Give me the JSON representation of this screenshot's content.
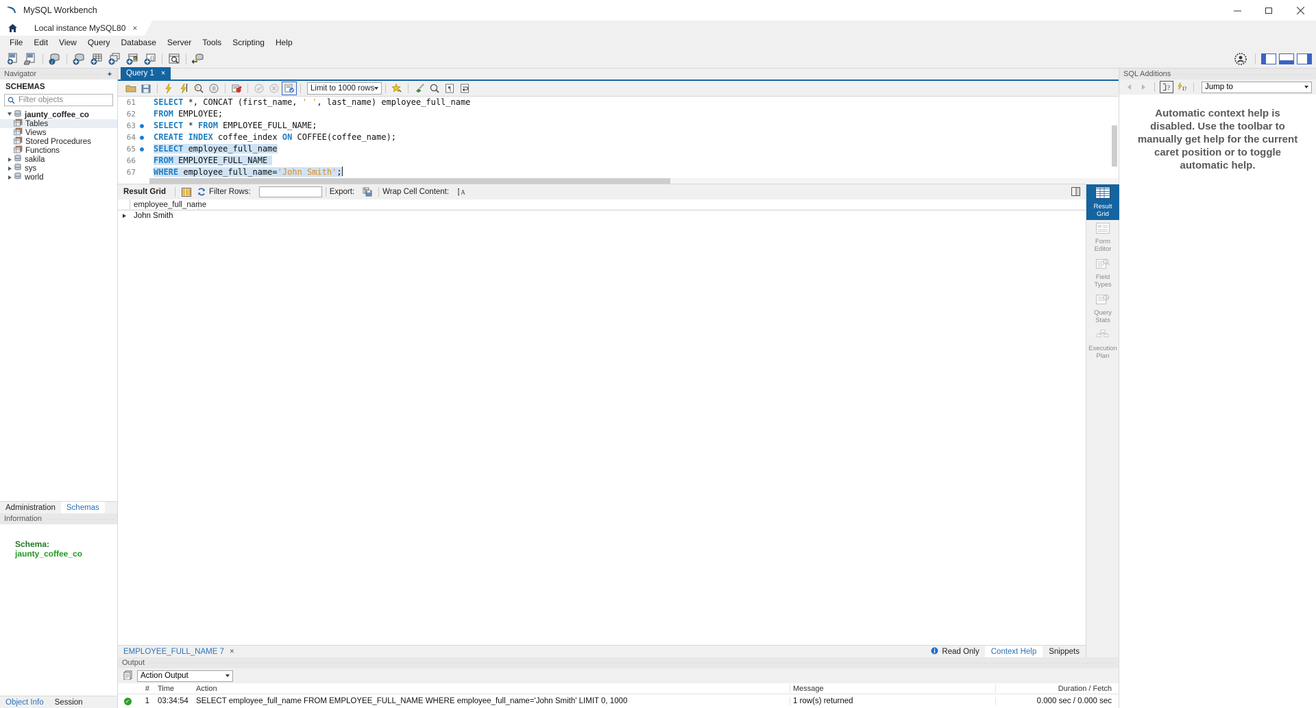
{
  "window": {
    "title": "MySQL Workbench",
    "icon": "mysql-dolphin-icon",
    "minimize": "minimize",
    "maximize": "maximize",
    "close": "close"
  },
  "tabs": {
    "home": "home-icon",
    "instance": "Local instance MySQL80",
    "instance_close": "×"
  },
  "menu": {
    "items": [
      "File",
      "Edit",
      "View",
      "Query",
      "Database",
      "Server",
      "Tools",
      "Scripting",
      "Help"
    ]
  },
  "toolbar": {
    "icons": [
      "new-sql-tab-icon",
      "open-sql-script-icon",
      "server-status-icon",
      "create-schema-icon",
      "create-table-icon",
      "create-view-icon",
      "create-procedure-icon",
      "create-function-icon",
      "search-data-icon",
      "reconnect-server-icon"
    ],
    "right_icons": [
      "user-account-icon"
    ],
    "panel_toggles": [
      "toggle-sidebar",
      "toggle-output",
      "toggle-secondary-sidebar"
    ],
    "accent_color": "#3b63c4"
  },
  "navigator": {
    "header": "Navigator",
    "collapse_icon": "collapse-icon",
    "section_label": "SCHEMAS",
    "filter_placeholder": "Filter objects",
    "search_icon": "search-icon",
    "tree": [
      {
        "label": "jaunty_coffee_co",
        "level": 0,
        "expanded": true,
        "bold": true,
        "icon": "schema-icon",
        "selected": false
      },
      {
        "label": "Tables",
        "level": 1,
        "expanded": false,
        "bold": false,
        "icon": "table-group-icon",
        "selected": true
      },
      {
        "label": "Views",
        "level": 1,
        "expanded": false,
        "bold": false,
        "icon": "view-group-icon",
        "selected": false
      },
      {
        "label": "Stored Procedures",
        "level": 1,
        "expanded": false,
        "bold": false,
        "icon": "procedure-group-icon",
        "selected": false
      },
      {
        "label": "Functions",
        "level": 1,
        "expanded": false,
        "bold": false,
        "icon": "function-group-icon",
        "selected": false
      },
      {
        "label": "sakila",
        "level": 0,
        "expanded": false,
        "bold": false,
        "icon": "schema-icon",
        "selected": false
      },
      {
        "label": "sys",
        "level": 0,
        "expanded": false,
        "bold": false,
        "icon": "schema-icon",
        "selected": false
      },
      {
        "label": "world",
        "level": 0,
        "expanded": false,
        "bold": false,
        "icon": "schema-icon",
        "selected": false
      }
    ],
    "bottom_tabs": [
      {
        "label": "Administration",
        "active": false
      },
      {
        "label": "Schemas",
        "active": true
      }
    ],
    "information": {
      "header": "Information",
      "schema_label": "Schema:",
      "schema_value": "jaunty_coffee_co"
    },
    "object_tabs": [
      {
        "label": "Object Info",
        "active": true
      },
      {
        "label": "Session",
        "active": false
      }
    ]
  },
  "query": {
    "tab_label": "Query 1",
    "tab_close": "×",
    "toolbar": {
      "icons": [
        "open-file-icon",
        "save-file-icon",
        "execute-icon",
        "execute-current-statement-icon",
        "explain-icon",
        "stop-icon",
        "toggle-breakpoint-icon",
        "commit-icon",
        "rollback-icon",
        "auto-commit-icon"
      ],
      "limit_value": "Limit to 1000 rows",
      "right_icons": [
        "beautify-icon",
        "clear-context-icon",
        "find-icon",
        "invisible-chars-icon",
        "wrap-lines-icon"
      ]
    },
    "lines": [
      {
        "number": "61",
        "breakpoint": false,
        "tokens": [
          {
            "t": "SELECT",
            "c": "kw"
          },
          {
            "t": " *, ",
            "c": ""
          },
          {
            "t": "CONCAT",
            "c": ""
          },
          {
            "t": " (first_name, ",
            "c": ""
          },
          {
            "t": "' '",
            "c": "str"
          },
          {
            "t": ", last_name) employee_full_name",
            "c": ""
          }
        ]
      },
      {
        "number": "62",
        "breakpoint": false,
        "tokens": [
          {
            "t": "FROM",
            "c": "kw"
          },
          {
            "t": " EMPLOYEE;",
            "c": ""
          }
        ]
      },
      {
        "number": "63",
        "breakpoint": true,
        "tokens": [
          {
            "t": "SELECT",
            "c": "kw"
          },
          {
            "t": " * ",
            "c": ""
          },
          {
            "t": "FROM",
            "c": "kw"
          },
          {
            "t": " EMPLOYEE_FULL_NAME;",
            "c": ""
          }
        ]
      },
      {
        "number": "64",
        "breakpoint": true,
        "tokens": [
          {
            "t": "CREATE INDEX",
            "c": "kw"
          },
          {
            "t": " coffee_index ",
            "c": ""
          },
          {
            "t": "ON",
            "c": "kw"
          },
          {
            "t": " COFFEE(coffee_name);",
            "c": ""
          }
        ]
      },
      {
        "number": "65",
        "breakpoint": true,
        "highlight": true,
        "tokens": [
          {
            "t": "SELECT",
            "c": "kw"
          },
          {
            "t": " employee_full_name",
            "c": ""
          }
        ]
      },
      {
        "number": "66",
        "breakpoint": false,
        "highlight": true,
        "tokens": [
          {
            "t": "FROM",
            "c": "kw"
          },
          {
            "t": " EMPLOYEE_FULL_NAME",
            "c": ""
          }
        ]
      },
      {
        "number": "67",
        "breakpoint": false,
        "highlight": true,
        "caret": true,
        "tokens": [
          {
            "t": "WHERE",
            "c": "kw"
          },
          {
            "t": " employee_full_name=",
            "c": ""
          },
          {
            "t": "'John Smith'",
            "c": "str"
          },
          {
            "t": ";",
            "c": ""
          }
        ]
      }
    ]
  },
  "results": {
    "toolbar": {
      "title": "Result Grid",
      "grid-icon": "grid-view-icon",
      "refresh_icon": "refresh-icon",
      "filter_label": "Filter Rows:",
      "filter_value": "",
      "export_label": "Export:",
      "export_icon": "export-icon",
      "wrap_label": "Wrap Cell Content:",
      "wrap_icon": "wrap-cell-icon",
      "fetch_icon": "fetch-all-icon"
    },
    "columns": [
      "employee_full_name"
    ],
    "rows": [
      [
        "John Smith"
      ]
    ],
    "sidebar_tabs": [
      {
        "label": "Result\nGrid",
        "line1": "Result",
        "line2": "Grid",
        "icon": "result-grid-icon",
        "active": true
      },
      {
        "label": "Form Editor",
        "line1": "Form",
        "line2": "Editor",
        "icon": "form-editor-icon",
        "active": false
      },
      {
        "label": "Field Types",
        "line1": "Field",
        "line2": "Types",
        "icon": "field-types-icon",
        "active": false
      },
      {
        "label": "Query Stats",
        "line1": "Query",
        "line2": "Stats",
        "icon": "query-stats-icon",
        "active": false
      },
      {
        "label": "Execution Plan",
        "line1": "Execution",
        "line2": "Plan",
        "icon": "execution-plan-icon",
        "active": false
      }
    ],
    "status": {
      "result_tab": "EMPLOYEE_FULL_NAME 7",
      "result_tab_close": "×",
      "read_only": "Read Only",
      "info_icon": "info-icon",
      "right_tabs": [
        {
          "label": "Context Help",
          "active": true
        },
        {
          "label": "Snippets",
          "active": false
        }
      ]
    }
  },
  "output": {
    "header": "Output",
    "selector_value": "Action Output",
    "selector_icon": "output-list-icon",
    "columns": [
      "#",
      "Time",
      "Action",
      "Message",
      "Duration / Fetch"
    ],
    "rows": [
      {
        "status": "success",
        "num": "1",
        "time": "03:34:54",
        "action": "SELECT employee_full_name FROM EMPLOYEE_FULL_NAME WHERE employee_full_name='John Smith' LIMIT 0, 1000",
        "message": "1 row(s) returned",
        "duration": "0.000 sec / 0.000 sec"
      }
    ]
  },
  "sql_additions": {
    "header": "SQL Additions",
    "back_icon": "back-arrow-icon",
    "forward_icon": "forward-arrow-icon",
    "help_icon": "context-help-icon",
    "auto_help_icon": "automatic-help-icon",
    "jump_to_value": "Jump to",
    "message": "Automatic context help is disabled. Use the toolbar to manually get help for the current caret position or to toggle automatic help."
  }
}
